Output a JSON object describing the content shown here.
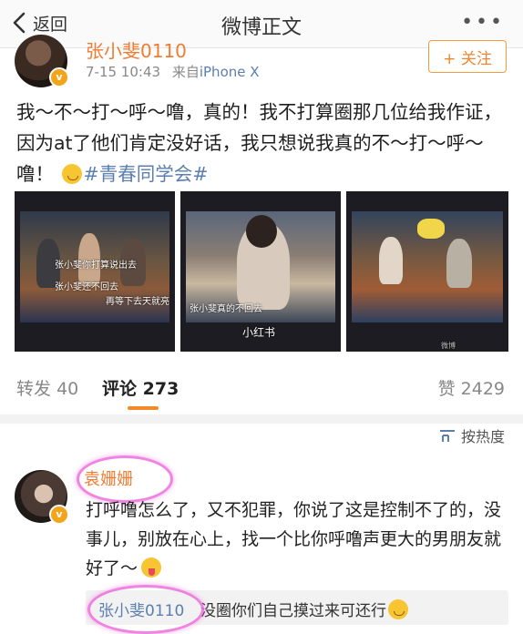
{
  "nav": {
    "back_label": "返回",
    "title": "微博正文",
    "more_label": "•••"
  },
  "post": {
    "author": "张小斐0110",
    "time": "7-15 10:43",
    "source_prefix": "来自",
    "source": "iPhone X",
    "follow_label": "+ 关注",
    "text": "我～不～打～呼～噜，真的！我不打算圈那几位给我作证，因为at了他们肯定没好话，我只想说我真的不～打～呼～噜！",
    "hashtag": "#青春同学会#",
    "photos": [
      {
        "captions": [
          "张小斐你打算说出去",
          "张小斐还不回去",
          "再等下去天就亮"
        ]
      },
      {
        "captions": [
          "张小斐真的不回去",
          "小红书"
        ]
      },
      {
        "captions": [
          "微博",
          "微博"
        ]
      }
    ]
  },
  "stats": {
    "repost_label": "转发",
    "repost_count": "40",
    "comment_label": "评论",
    "comment_count": "273",
    "like_label": "赞",
    "like_count": "2429"
  },
  "sort_label": "按热度",
  "comment": {
    "author": "袁姗姗",
    "text": "打呼噜怎么了，又不犯罪，你说了这是控制不了的，没事儿，别放在心上，找一个比你呼噜声更大的男朋友就好了～",
    "reply_author": "张小斐0110",
    "reply_text": "没圈你们自己摸过来可还行"
  },
  "colors": {
    "accent": "#f28a2a",
    "link": "#5b7fb0",
    "username": "#f27b32",
    "highlight_ring": "#ec6edc"
  }
}
